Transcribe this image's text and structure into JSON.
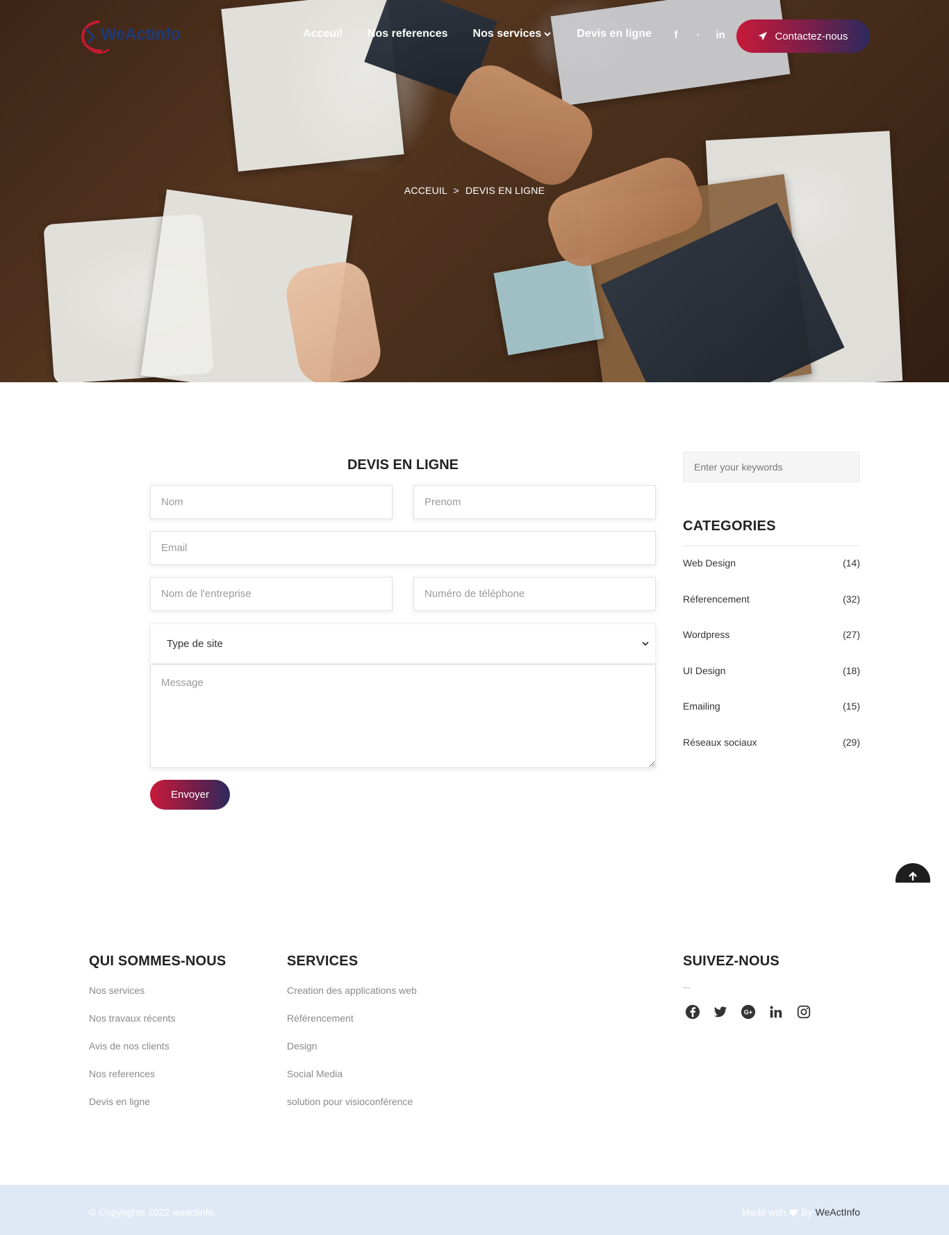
{
  "nav": {
    "logo_text": "WeActinfo",
    "links": [
      "Acceuil",
      "Nos references",
      "Nos services",
      "Devis en ligne"
    ],
    "social_icons": [
      "facebook-icon",
      "twitter-icon",
      "linkedin-icon"
    ],
    "contact_label": "Contactez-nous"
  },
  "hero": {
    "breadcrumb": {
      "home": "ACCEUIL",
      "separator": ">",
      "current": "DEVIS EN LIGNE"
    }
  },
  "form": {
    "title": "DEVIS EN LIGNE",
    "nom_placeholder": "Nom",
    "prenom_placeholder": "Prenom",
    "email_placeholder": "Email",
    "entreprise_placeholder": "Nom de l'entreprise",
    "telephone_placeholder": "Numéro de téléphone",
    "site_type_selected": "Type de site",
    "message_placeholder": "Message",
    "submit_label": "Envoyer"
  },
  "sidebar": {
    "search_placeholder": "Enter your keywords",
    "categories_title": "CATEGORIES",
    "categories": [
      {
        "label": "Web Design",
        "count": "(14)"
      },
      {
        "label": "Réferencement",
        "count": "(32)"
      },
      {
        "label": "Wordpress",
        "count": "(27)"
      },
      {
        "label": "UI Design",
        "count": "(18)"
      },
      {
        "label": "Emailing",
        "count": "(15)"
      },
      {
        "label": "Réseaux sociaux",
        "count": "(29)"
      }
    ]
  },
  "footer": {
    "about": {
      "title": "QUI SOMMES-NOUS",
      "links": [
        "Nos services",
        "Nos travaux récents",
        "Avis de nos clients",
        "Nos references",
        "Devis en ligne"
      ]
    },
    "services": {
      "title": "SERVICES",
      "links": [
        "Creation des applications web",
        "Référencement",
        "Design",
        "Social Media",
        "solution pour visioconférence"
      ]
    },
    "follow": {
      "title": "SUIVEZ-NOUS",
      "dots": "...",
      "icons": [
        "facebook-icon",
        "twitter-icon",
        "google-plus-icon",
        "linkedin-icon",
        "instagram-icon"
      ]
    },
    "copyright": "© Copyrights 2022 weactinfo.",
    "made_with": "Made with",
    "by": "By",
    "brand": "WeActInfo"
  },
  "colors": {
    "accent_start": "#c81a3a",
    "accent_end": "#2c2a5e",
    "logo_blue": "#1e3a78",
    "copyright_bg": "#dfe9f5"
  }
}
